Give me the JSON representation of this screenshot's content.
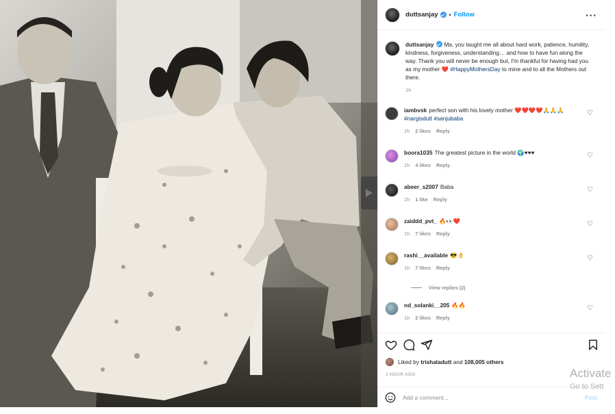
{
  "post": {
    "username": "duttsanjay",
    "follow_label": "Follow",
    "more_label": "···",
    "photo_alt_icon": "photo-image"
  },
  "caption": {
    "username": "duttsanjay",
    "text": "Ma, you taught me all about hard work, patience, humility, kindness, forgiveness, understanding… and how to have fun along the way. Thank you will never be enough but, I'm thankful for having had you as my mother ❤️",
    "hashtag": "#HappyMothersDay",
    "text_end": " to mine and to all the Mothers out there.",
    "time": "1h"
  },
  "comments": [
    {
      "username": "iambvsk",
      "text": "perfect son with his lovely mother ❤️❤️❤️❤️🙏🙏🙏",
      "tags": "#nargisdutt #sanjubaba",
      "time": "1h",
      "likes": "2 likes",
      "reply": "Reply",
      "avatar_color": "#3c3c3c"
    },
    {
      "username": "boora1035",
      "text": "The greatest picture in the world 🌍♥♥♥",
      "time": "1h",
      "likes": "4 likes",
      "reply": "Reply",
      "avatar_color": "#b36bd1"
    },
    {
      "username": "abeer_s2007",
      "text": "Baba",
      "time": "1h",
      "likes": "1 like",
      "reply": "Reply",
      "avatar_color": "#2a2a2a"
    },
    {
      "username": "zaiddd_pvt_",
      "text": "🔥👀❤️",
      "time": "1h",
      "likes": "7 likes",
      "reply": "Reply",
      "avatar_color": "#c99a7e"
    },
    {
      "username": "rashi__available",
      "text": "😎👌",
      "time": "1h",
      "likes": "7 likes",
      "reply": "Reply",
      "avatar_color": "#8a6a3a"
    },
    {
      "username": "nd_solanki__205",
      "text": "🔥🔥",
      "time": "1h",
      "likes": "2 likes",
      "reply": "Reply",
      "avatar_color": "#6a8a9a"
    }
  ],
  "view_replies": "View replies (2)",
  "likes": {
    "liked_by_prefix": "Liked by ",
    "liked_by_user": "trishaladutt",
    "liked_by_mid": " and ",
    "others": "108,005 others"
  },
  "time_ago": "1 HOUR AGO",
  "add_comment": {
    "placeholder": "Add a comment...",
    "post_label": "Post"
  },
  "watermark": {
    "line1": "Activate",
    "line2": "Go to Sett"
  },
  "colors": {
    "link_blue": "#0095f6",
    "hashtag": "#00376b",
    "muted": "#8e8e8e",
    "post_disabled": "#b2dffc"
  }
}
